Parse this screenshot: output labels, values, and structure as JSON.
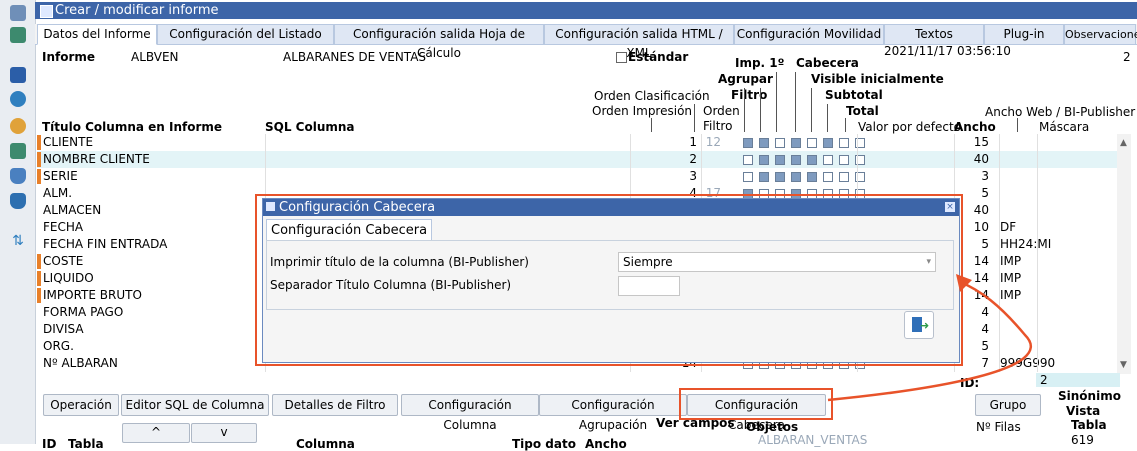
{
  "window": {
    "title": "Crear / modificar informe"
  },
  "tabs": [
    {
      "label": "Datos del Informe"
    },
    {
      "label": "Configuración del Listado"
    },
    {
      "label": "Configuración salida Hoja de Cálculo"
    },
    {
      "label": "Configuración salida HTML / XML"
    },
    {
      "label": "Configuración Movilidad"
    },
    {
      "label": "Textos"
    },
    {
      "label": "Plug-in"
    },
    {
      "label": "Observaciones"
    }
  ],
  "header": {
    "informe_label": "Informe",
    "informe_code": "ALBVEN",
    "informe_name": "ALBARANES DE VENTAS",
    "estandar_label": "Estándar",
    "timestamp": "2021/11/17 03:56:10",
    "counter": "2"
  },
  "columns": {
    "imp1": "Imp. 1º",
    "cabecera": "Cabecera",
    "agrupar": "Agrupar",
    "visible": "Visible inicialmente",
    "filtro": "Filtro",
    "subtotal": "Subtotal",
    "total": "Total",
    "orden_clasificacion": "Orden Clasificación",
    "orden_impresion": "Orden Impresión",
    "orden": "Orden",
    "filtro2": "Filtro",
    "ancho_web": "Ancho Web / BI-Publisher",
    "titulo": "Título Columna en Informe",
    "sql": "SQL Columna",
    "valor_defecto": "Valor por defecto",
    "ancho": "Ancho",
    "mascara": "Máscara"
  },
  "rows": [
    {
      "name": "CLIENTE",
      "orden": "1",
      "filtro": "12",
      "ancho": "15",
      "mascara": "",
      "marked": true,
      "selected": false,
      "checks": [
        1,
        1,
        0,
        1,
        0,
        1,
        0,
        0
      ]
    },
    {
      "name": "NOMBRE CLIENTE",
      "orden": "2",
      "filtro": "",
      "ancho": "40",
      "mascara": "",
      "marked": true,
      "selected": true,
      "checks": [
        0,
        1,
        1,
        1,
        1,
        0,
        0,
        0
      ]
    },
    {
      "name": "SERIE",
      "orden": "3",
      "filtro": "",
      "ancho": "3",
      "mascara": "",
      "marked": true,
      "selected": false,
      "checks": [
        0,
        1,
        1,
        1,
        1,
        0,
        0,
        0
      ]
    },
    {
      "name": "ALM.",
      "orden": "4",
      "filtro": "17",
      "ancho": "5",
      "mascara": "",
      "marked": false,
      "selected": false,
      "checks": [
        1,
        0,
        0,
        1,
        0,
        0,
        0,
        0
      ]
    },
    {
      "name": "ALMACEN",
      "orden": "",
      "filtro": "",
      "ancho": "40",
      "mascara": "",
      "marked": false,
      "selected": false,
      "checks": []
    },
    {
      "name": "FECHA",
      "orden": "",
      "filtro": "",
      "ancho": "10",
      "mascara": "DF",
      "marked": false,
      "selected": false,
      "checks": []
    },
    {
      "name": "FECHA FIN ENTRADA",
      "orden": "",
      "filtro": "",
      "ancho": "5",
      "mascara": "HH24:MI",
      "marked": false,
      "selected": false,
      "checks": []
    },
    {
      "name": "COSTE",
      "orden": "",
      "filtro": "",
      "ancho": "14",
      "mascara": "IMP",
      "marked": true,
      "selected": false,
      "checks": []
    },
    {
      "name": "LIQUIDO",
      "orden": "",
      "filtro": "",
      "ancho": "14",
      "mascara": "IMP",
      "marked": true,
      "selected": false,
      "checks": []
    },
    {
      "name": "IMPORTE BRUTO",
      "orden": "",
      "filtro": "",
      "ancho": "14",
      "mascara": "IMP",
      "marked": true,
      "selected": false,
      "checks": []
    },
    {
      "name": "FORMA PAGO",
      "orden": "",
      "filtro": "",
      "ancho": "4",
      "mascara": "",
      "marked": false,
      "selected": false,
      "checks": []
    },
    {
      "name": "DIVISA",
      "orden": "",
      "filtro": "",
      "ancho": "4",
      "mascara": "",
      "marked": false,
      "selected": false,
      "checks": []
    },
    {
      "name": "ORG.",
      "orden": "",
      "filtro": "",
      "ancho": "5",
      "mascara": "",
      "marked": false,
      "selected": false,
      "checks": []
    },
    {
      "name": "Nº ALBARAN",
      "orden": "14",
      "filtro": "",
      "ancho": "7",
      "mascara": "999G990",
      "marked": false,
      "selected": false,
      "checks": [
        0,
        0,
        0,
        0,
        0,
        0,
        0,
        0
      ]
    }
  ],
  "id": {
    "label": "ID:",
    "value": "2"
  },
  "buttons": [
    {
      "label": "Operación"
    },
    {
      "label": "Editor SQL de Columna"
    },
    {
      "label": "Detalles de Filtro"
    },
    {
      "label": "Configuración Columna"
    },
    {
      "label": "Configuración Agrupación"
    },
    {
      "label": "Configuración Cabecera"
    },
    {
      "label": "Grupo"
    }
  ],
  "bottom": {
    "sinonimo": "Sinónimo",
    "vista": "Vista",
    "tabla": "Tabla",
    "ver_campos": "Ver campos",
    "objetos": "Objetos",
    "num_filas": "Nº Filas",
    "id": "ID",
    "tabla_col": "Tabla",
    "columna": "Columna",
    "tipo_dato": "Tipo dato",
    "ancho": "Ancho",
    "objeto": "ALBARAN_VENTAS",
    "filas": "619",
    "up": "^",
    "down": "v"
  },
  "dialog": {
    "title": "Configuración Cabecera",
    "tab": "Configuración Cabecera",
    "imprimir_label": "Imprimir título de la columna (BI-Publisher)",
    "imprimir_value": "Siempre",
    "separador_label": "Separador Título Columna (BI-Publisher)",
    "separador_value": ""
  },
  "colors": {
    "accent": "#3d65a8",
    "highlight": "#e8532a",
    "selected_row": "#e3f4f7",
    "marker": "#e8802a"
  }
}
